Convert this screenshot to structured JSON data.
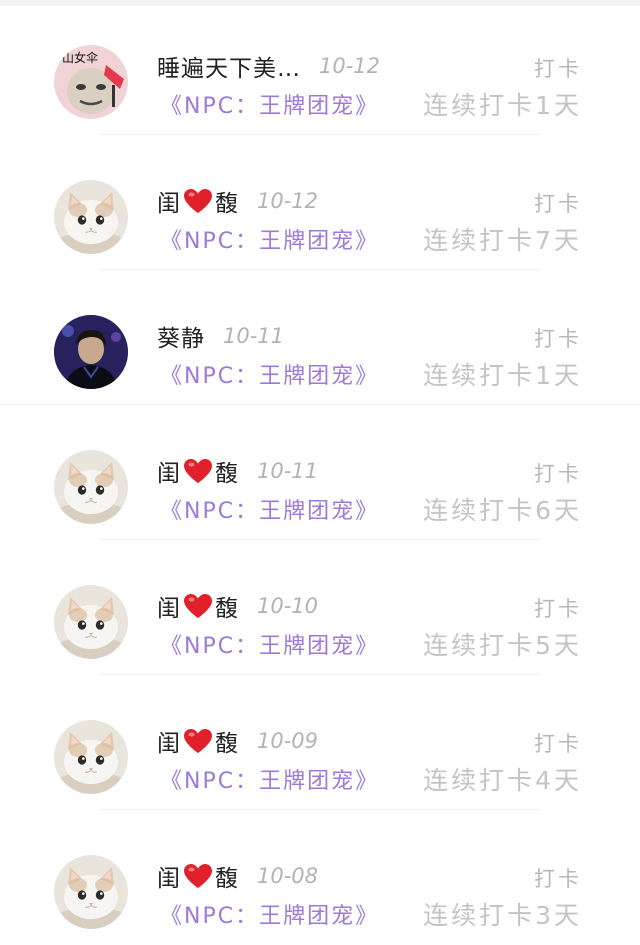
{
  "checkin_label": "打卡",
  "book_title": "《NPC：王牌团宠》",
  "heart_symbol": "❤️",
  "colors": {
    "username": "#222222",
    "book_title": "#9d7ad8",
    "date": "#b3b3b3",
    "streak": "#c4c4c4",
    "heart": "#e0202b"
  },
  "entries": [
    {
      "name_before": "睡遍天下美…",
      "heart": false,
      "name_after": "",
      "date": "10-12",
      "streak": "连续打卡1天",
      "avatar": "meme-avatar"
    },
    {
      "name_before": "闺",
      "heart": true,
      "name_after": "馥",
      "date": "10-12",
      "streak": "连续打卡7天",
      "avatar": "cat-avatar"
    },
    {
      "name_before": "葵静",
      "heart": false,
      "name_after": "",
      "date": "10-11",
      "streak": "连续打卡1天",
      "avatar": "dark-portrait-avatar"
    },
    {
      "name_before": "闺",
      "heart": true,
      "name_after": "馥",
      "date": "10-11",
      "streak": "连续打卡6天",
      "avatar": "cat-avatar"
    },
    {
      "name_before": "闺",
      "heart": true,
      "name_after": "馥",
      "date": "10-10",
      "streak": "连续打卡5天",
      "avatar": "cat-avatar"
    },
    {
      "name_before": "闺",
      "heart": true,
      "name_after": "馥",
      "date": "10-09",
      "streak": "连续打卡4天",
      "avatar": "cat-avatar"
    },
    {
      "name_before": "闺",
      "heart": true,
      "name_after": "馥",
      "date": "10-08",
      "streak": "连续打卡3天",
      "avatar": "cat-avatar"
    }
  ],
  "meme_avatar_text": "山女伞"
}
